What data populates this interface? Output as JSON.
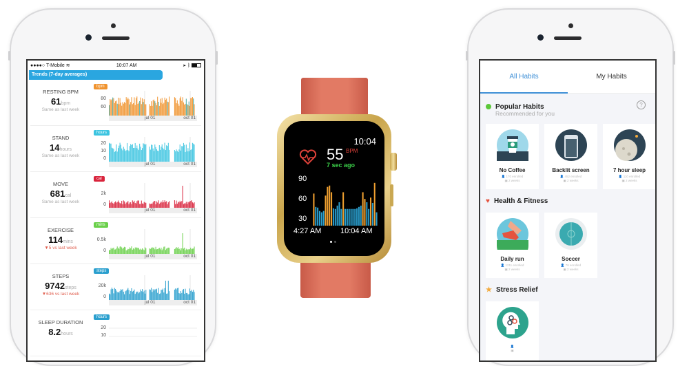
{
  "left_phone": {
    "status_bar": {
      "carrier": "●●●●○ T-Mobile",
      "wifi_icon": "wifi-icon",
      "time": "10:07 AM",
      "right_icons": [
        "location-icon",
        "bluetooth-icon",
        "battery-icon"
      ]
    },
    "banner": "Trends (7-day averages)",
    "x_labels": [
      "jul 01",
      "oct 01"
    ],
    "metrics": [
      {
        "label": "RESTING BPM",
        "value": "61",
        "unit": "bpm",
        "sub": "Same as last week",
        "badge": "bpm",
        "color": "#f0932e",
        "alt_color": "#4aa8a0",
        "yticks": [
          "80",
          "60"
        ],
        "trend": "same"
      },
      {
        "label": "STAND",
        "value": "14",
        "unit": "hours",
        "sub": "Same as last week",
        "badge": "hours",
        "color": "#3cc4e0",
        "yticks": [
          "20",
          "10",
          "0"
        ],
        "trend": "same"
      },
      {
        "label": "MOVE",
        "value": "681",
        "unit": "cal",
        "sub": "Same as last week",
        "badge": "cal",
        "color": "#d9243c",
        "yticks": [
          "2k",
          "0"
        ],
        "trend": "same"
      },
      {
        "label": "EXERCISE",
        "value": "114",
        "unit": "mins",
        "sub": "▼5 vs last week",
        "badge": "mins",
        "color": "#6ad04a",
        "yticks": [
          "0.5k",
          "0"
        ],
        "trend": "down"
      },
      {
        "label": "STEPS",
        "value": "9742",
        "unit": "steps",
        "sub": "▼636 vs last week",
        "badge": "steps",
        "color": "#2a9fce",
        "yticks": [
          "20k",
          "0"
        ],
        "trend": "down"
      },
      {
        "label": "SLEEP DURATION",
        "value": "8.2",
        "unit": "hours",
        "sub": "",
        "badge": "hours",
        "color": "#2a9fce",
        "yticks": [
          "20",
          "10"
        ],
        "trend": "same"
      }
    ]
  },
  "watch": {
    "time": "10:04",
    "bpm_value": "55",
    "bpm_unit": "BPM",
    "last_reading": "7 sec ago",
    "y_ticks": [
      "90",
      "60",
      "30"
    ],
    "x_start": "4:27 AM",
    "x_end": "10:04 AM",
    "bar_colors": {
      "high": "#f0a030",
      "low": "#2a9fce"
    },
    "heart_rate_series": [
      78,
      58,
      57,
      52,
      50,
      52,
      75,
      88,
      90,
      80,
      56,
      55,
      60,
      65,
      55,
      80,
      55,
      55,
      55,
      55,
      55,
      55,
      56,
      58,
      60,
      80,
      70,
      65,
      55,
      72,
      64,
      94,
      50
    ],
    "page_indicator": {
      "count": 2,
      "active": 0
    }
  },
  "right_phone": {
    "tabs": [
      {
        "label": "All Habits",
        "active": true
      },
      {
        "label": "My Habits",
        "active": false
      }
    ],
    "categories": [
      {
        "title": "Popular Habits",
        "subtitle": "Recommended for you",
        "icon": "green-dot-icon",
        "color": "#5cc83a",
        "has_help": true,
        "habits": [
          {
            "name": "No Coffee",
            "enrolled": "170 enrolled",
            "duration": "2 weeks",
            "icon": "coffee-cup-icon"
          },
          {
            "name": "Backlit screen",
            "enrolled": "452 enrolled",
            "duration": "2 weeks",
            "icon": "phone-screen-icon"
          },
          {
            "name": "7 hour sleep",
            "enrolled": "110 enrolled",
            "duration": "2 weeks",
            "icon": "moon-icon"
          }
        ]
      },
      {
        "title": "Health & Fitness",
        "subtitle": "",
        "icon": "heart-icon",
        "color": "#e5533f",
        "has_help": false,
        "habits": [
          {
            "name": "Daily run",
            "enrolled": "1211 enrolled",
            "duration": "2 weeks",
            "icon": "running-shoe-icon"
          },
          {
            "name": "Soccer",
            "enrolled": "76 enrolled",
            "duration": "2 weeks",
            "icon": "soccer-field-icon"
          }
        ]
      },
      {
        "title": "Stress Relief",
        "subtitle": "",
        "icon": "star-icon",
        "color": "#f2a93b",
        "has_help": false,
        "habits": [
          {
            "name": "",
            "enrolled": "",
            "duration": "",
            "icon": "mind-gears-icon"
          }
        ]
      }
    ],
    "help_label": "?"
  }
}
